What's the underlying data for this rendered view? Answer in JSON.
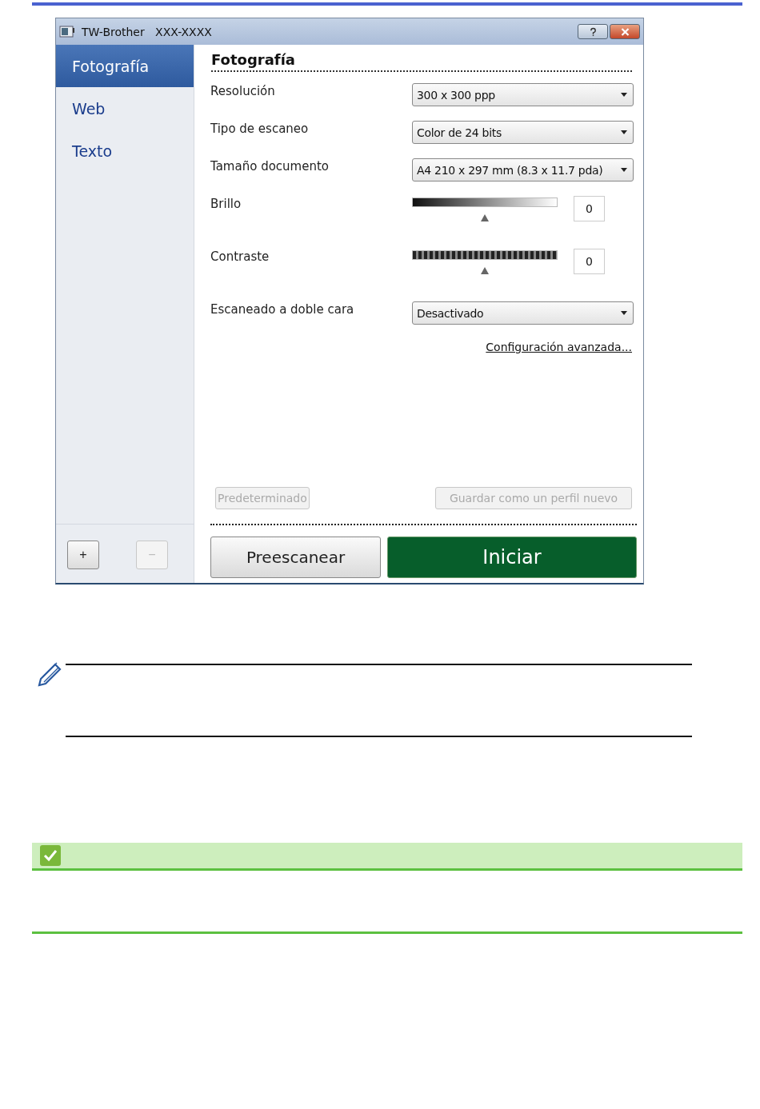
{
  "window": {
    "title": "TW-Brother   XXX-XXXX"
  },
  "sidebar": {
    "items": [
      {
        "label": "Fotografía",
        "selected": true
      },
      {
        "label": "Web",
        "selected": false
      },
      {
        "label": "Texto",
        "selected": false
      }
    ],
    "buttons": [
      {
        "label": "+",
        "disabled": false
      },
      {
        "label": "−",
        "disabled": true
      }
    ]
  },
  "panel": {
    "title": "Fotografía",
    "settings": [
      {
        "kind": "dropdown",
        "label": "Resolución",
        "value": "300 x 300 ppp"
      },
      {
        "kind": "dropdown",
        "label": "Tipo de escaneo",
        "value": "Color de 24 bits"
      },
      {
        "kind": "dropdown",
        "label": "Tamaño documento",
        "value": "A4 210 x 297 mm (8.3 x 11.7 pda)"
      },
      {
        "kind": "slider",
        "label": "Brillo",
        "striped": false,
        "level": 0.5,
        "value": "0"
      },
      {
        "kind": "slider",
        "label": "Contraste",
        "striped": true,
        "level": 0.5,
        "value": "0"
      },
      {
        "kind": "dropdown",
        "label": "Escaneado a doble cara",
        "value": "Desactivado"
      }
    ],
    "advanced_link": "Configuración avanzada...",
    "profile_buttons": [
      {
        "label": "Predeterminado",
        "disabled": true
      },
      {
        "label": "Guardar como un perfil nuevo",
        "disabled": true
      }
    ],
    "actions": [
      {
        "label": "Preescanear",
        "primary": false
      },
      {
        "label": "Iniciar",
        "primary": true
      }
    ]
  }
}
